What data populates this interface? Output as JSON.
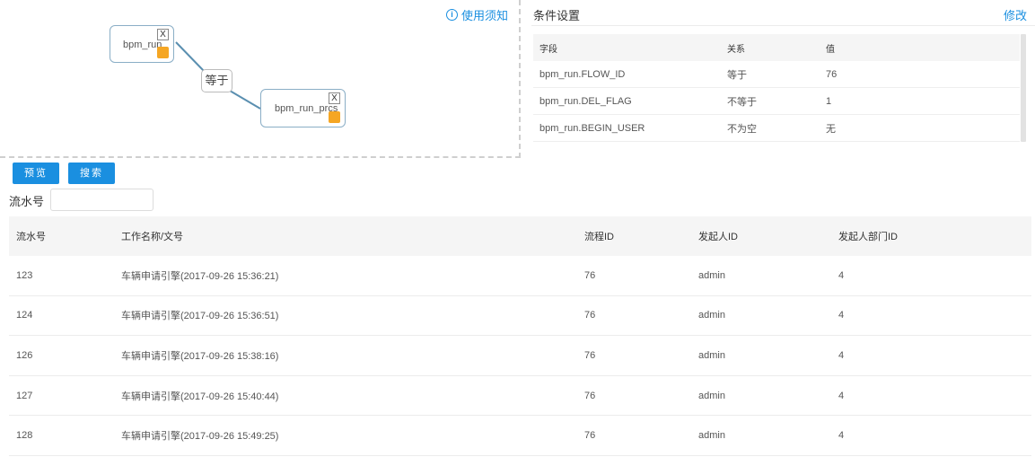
{
  "diagram": {
    "usage_link": "使用须知",
    "nodes": [
      {
        "label": "bpm_run",
        "close": "X"
      },
      {
        "label": "bpm_run_prcs",
        "close": "X"
      }
    ],
    "join_label": "等于"
  },
  "conditions": {
    "title": "条件设置",
    "edit_label": "修改",
    "columns": [
      "字段",
      "关系",
      "值"
    ],
    "rows": [
      [
        "bpm_run.FLOW_ID",
        "等于",
        "76"
      ],
      [
        "bpm_run.DEL_FLAG",
        "不等于",
        "1"
      ],
      [
        "bpm_run.BEGIN_USER",
        "不为空",
        "无"
      ]
    ]
  },
  "toolbar": {
    "preview_label": "预览",
    "search_label": "搜索"
  },
  "filter": {
    "label": "流水号",
    "value": ""
  },
  "table": {
    "columns": [
      "流水号",
      "工作名称/文号",
      "流程ID",
      "发起人ID",
      "发起人部门ID"
    ],
    "rows": [
      [
        "123",
        "车辆申请引擎(2017-09-26 15:36:21)",
        "76",
        "admin",
        "4"
      ],
      [
        "124",
        "车辆申请引擎(2017-09-26 15:36:51)",
        "76",
        "admin",
        "4"
      ],
      [
        "126",
        "车辆申请引擎(2017-09-26 15:38:16)",
        "76",
        "admin",
        "4"
      ],
      [
        "127",
        "车辆申请引擎(2017-09-26 15:40:44)",
        "76",
        "admin",
        "4"
      ],
      [
        "128",
        "车辆申请引擎(2017-09-26 15:49:25)",
        "76",
        "admin",
        "4"
      ]
    ]
  },
  "colors": {
    "accent": "#1a8fe0",
    "handle": "#f5a623",
    "connector": "#5a8fb0"
  }
}
